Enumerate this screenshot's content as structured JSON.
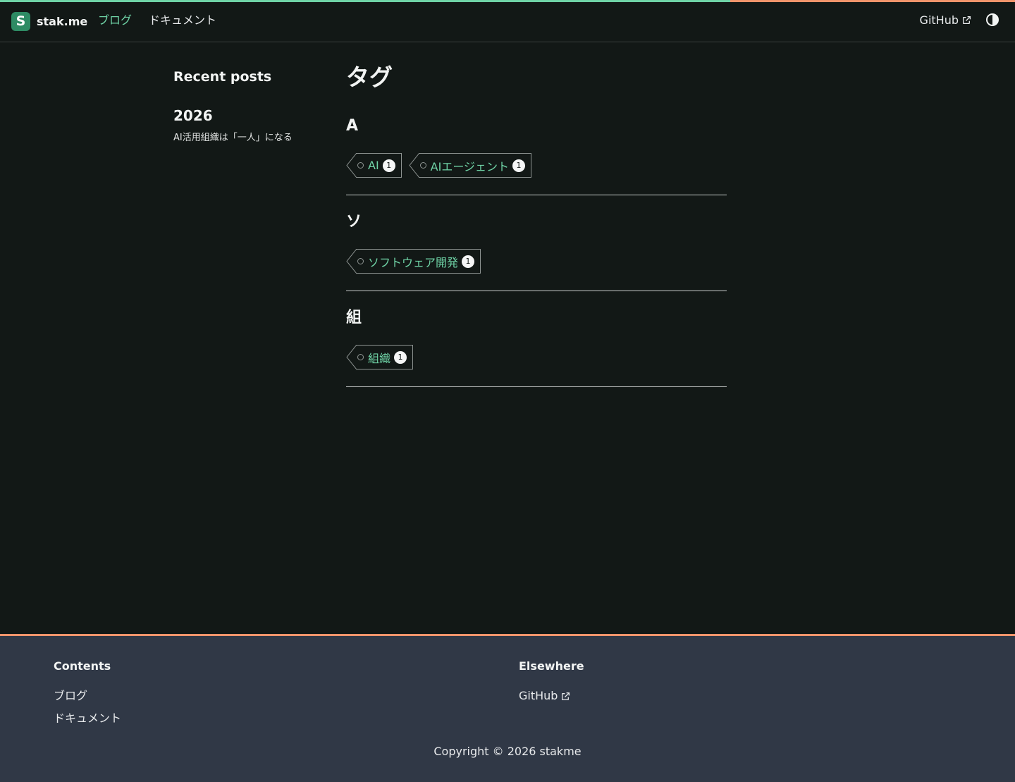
{
  "colors": {
    "accent_green": "#6fd3a6",
    "accent_orange": "#f0946b",
    "logo_bg": "#2e8b64",
    "page_bg": "#121816",
    "footer_bg": "#303846"
  },
  "navbar": {
    "logo_letter": "S",
    "brand": "stak.me",
    "links": [
      {
        "label": "ブログ",
        "active": true
      },
      {
        "label": "ドキュメント",
        "active": false
      }
    ],
    "github_label": "GitHub",
    "github_icon": "external-link-icon",
    "theme_icon": "half-circle-theme-icon"
  },
  "sidebar": {
    "title": "Recent posts",
    "year": "2026",
    "posts": [
      "AI活用組織は「一人」になる"
    ]
  },
  "main": {
    "title": "タグ",
    "groups": [
      {
        "letter": "A",
        "tags": [
          {
            "name": "AI",
            "count": "1"
          },
          {
            "name": "AIエージェント",
            "count": "1"
          }
        ]
      },
      {
        "letter": "ソ",
        "tags": [
          {
            "name": "ソフトウェア開発",
            "count": "1"
          }
        ]
      },
      {
        "letter": "組",
        "tags": [
          {
            "name": "組織",
            "count": "1"
          }
        ]
      }
    ]
  },
  "footer": {
    "contents_title": "Contents",
    "contents_links": [
      "ブログ",
      "ドキュメント"
    ],
    "elsewhere_title": "Elsewhere",
    "elsewhere_links": [
      "GitHub"
    ],
    "copyright": "Copyright © 2026 stakme"
  }
}
